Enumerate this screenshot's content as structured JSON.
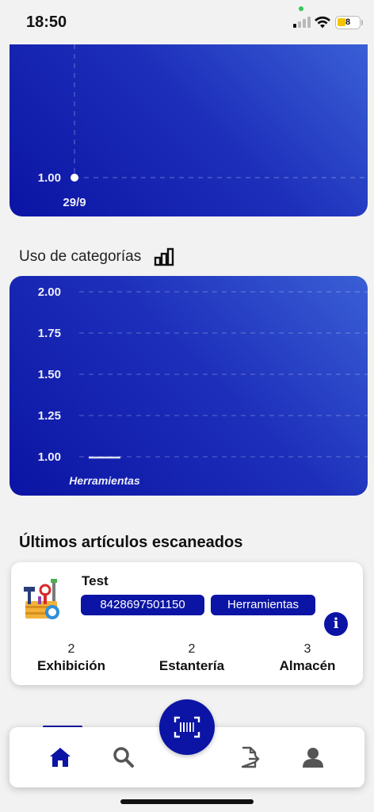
{
  "status_bar": {
    "time": "18:50",
    "battery": "8"
  },
  "chart_data": [
    {
      "type": "line",
      "x": [
        "29/9"
      ],
      "y_ticks": [
        "1.00"
      ],
      "series": [
        {
          "values": [
            1.0
          ]
        }
      ],
      "grid": true
    },
    {
      "type": "bar",
      "categories": [
        "Herramientas"
      ],
      "values": [
        1.0
      ],
      "y_ticks": [
        "2.00",
        "1.75",
        "1.50",
        "1.25",
        "1.00"
      ],
      "ylim": [
        1.0,
        2.0
      ],
      "grid": true
    }
  ],
  "category_usage": {
    "title": "Uso de categorías",
    "icon": "bar-chart-icon"
  },
  "recent": {
    "title": "Últimos artículos escaneados",
    "item": {
      "name": "Test",
      "code": "8428697501150",
      "category": "Herramientas",
      "info_label": "i",
      "stocks": [
        {
          "count": "2",
          "label": "Exhibición"
        },
        {
          "count": "2",
          "label": "Estantería"
        },
        {
          "count": "3",
          "label": "Almacén"
        }
      ]
    }
  },
  "nav": {
    "items": [
      "home-icon",
      "search-icon",
      "export-file-icon",
      "user-icon"
    ],
    "active": "home-icon",
    "accent": "#0b14a4",
    "scan": "barcode-scan-icon"
  }
}
